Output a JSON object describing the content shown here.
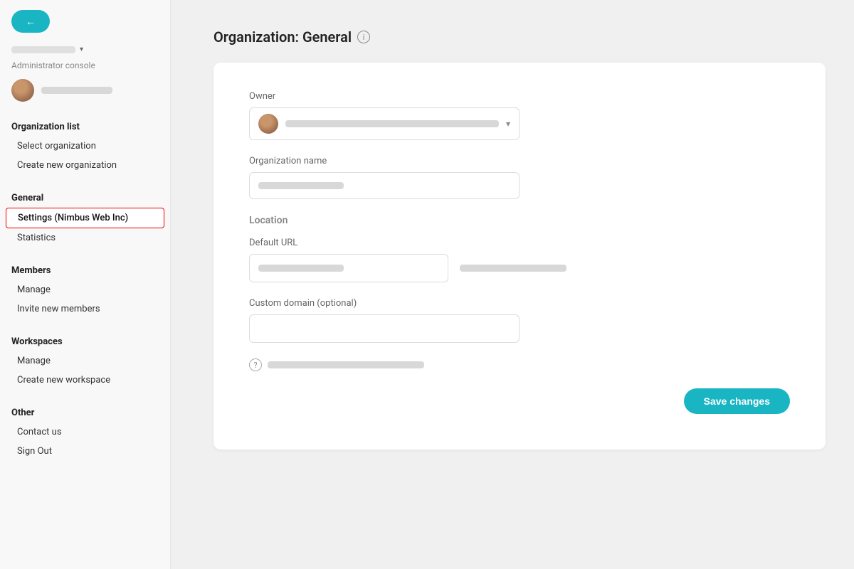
{
  "sidebar": {
    "back_button_label": "←",
    "org_selector_placeholder": "",
    "admin_console_label": "Administrator console",
    "user_name_placeholder": "",
    "sections": [
      {
        "header": "Organization list",
        "items": [
          {
            "id": "select-organization",
            "label": "Select organization",
            "active": false
          },
          {
            "id": "create-new-organization",
            "label": "Create new organization",
            "active": false
          }
        ]
      },
      {
        "header": "General",
        "items": [
          {
            "id": "settings-nimbus",
            "label": "Settings (Nimbus Web Inc)",
            "active": true
          },
          {
            "id": "statistics",
            "label": "Statistics",
            "active": false
          }
        ]
      },
      {
        "header": "Members",
        "items": [
          {
            "id": "members-manage",
            "label": "Manage",
            "active": false
          },
          {
            "id": "invite-new-members",
            "label": "Invite new members",
            "active": false
          }
        ]
      },
      {
        "header": "Workspaces",
        "items": [
          {
            "id": "workspaces-manage",
            "label": "Manage",
            "active": false
          },
          {
            "id": "create-new-workspace",
            "label": "Create new workspace",
            "active": false
          }
        ]
      },
      {
        "header": "Other",
        "items": [
          {
            "id": "contact-us",
            "label": "Contact us",
            "active": false
          },
          {
            "id": "sign-out",
            "label": "Sign Out",
            "active": false
          }
        ]
      }
    ]
  },
  "page": {
    "title": "Organization: General",
    "info_icon_label": "i"
  },
  "form": {
    "owner_label": "Owner",
    "organization_name_label": "Organization name",
    "location_label": "Location",
    "default_url_label": "Default URL",
    "custom_domain_label": "Custom domain (optional)",
    "save_changes_label": "Save changes",
    "question_icon_label": "?"
  },
  "colors": {
    "accent": "#1ab5c3",
    "active_border": "#e00000"
  }
}
